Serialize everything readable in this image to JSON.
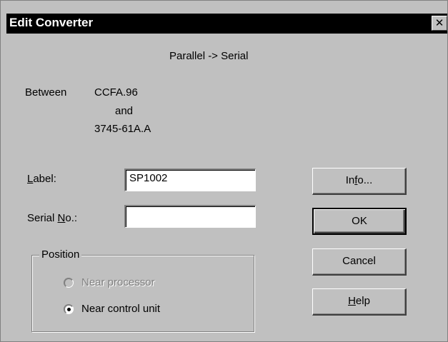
{
  "window": {
    "title": "Edit Converter",
    "close_glyph": "✕"
  },
  "header": {
    "type_text": "Parallel -> Serial"
  },
  "between": {
    "label": "Between",
    "first": "CCFA.96",
    "and": "and",
    "second": "3745-61A.A"
  },
  "form": {
    "label_field": {
      "label_prefix": "",
      "label_mnemonic": "L",
      "label_rest": "abel:",
      "value": "SP1002"
    },
    "serial_field": {
      "label_prefix": "Serial ",
      "label_mnemonic": "N",
      "label_rest": "o.:",
      "value": ""
    }
  },
  "position_group": {
    "legend": "Position",
    "options": [
      {
        "label": "Near processor",
        "selected": false,
        "enabled": false
      },
      {
        "label": "Near control unit",
        "selected": true,
        "enabled": true
      }
    ]
  },
  "buttons": {
    "info": {
      "prefix": "In",
      "mnemonic": "f",
      "rest": "o..."
    },
    "ok": {
      "label": "OK"
    },
    "cancel": {
      "label": "Cancel"
    },
    "help": {
      "prefix": "",
      "mnemonic": "H",
      "rest": "elp"
    }
  }
}
